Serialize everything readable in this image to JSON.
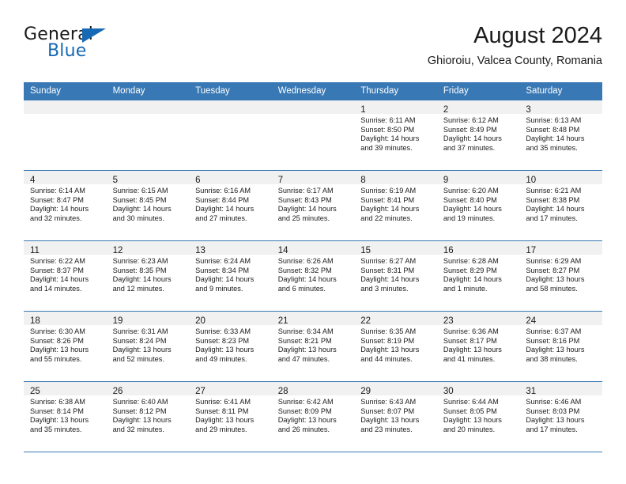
{
  "brand": {
    "name_top": "General",
    "name_bottom": "Blue",
    "accent_color": "#1669b5",
    "flag_icon": "triangle-flag-icon"
  },
  "header": {
    "title": "August 2024",
    "subtitle": "Ghioroiu, Valcea County, Romania"
  },
  "calendar": {
    "header_bg": "#3878b4",
    "daynum_bg": "#f1f1f1",
    "weekdays": [
      "Sunday",
      "Monday",
      "Tuesday",
      "Wednesday",
      "Thursday",
      "Friday",
      "Saturday"
    ],
    "labels": {
      "sunrise": "Sunrise:",
      "sunset": "Sunset:",
      "daylight": "Daylight:"
    },
    "weeks": [
      [
        {
          "day": ""
        },
        {
          "day": ""
        },
        {
          "day": ""
        },
        {
          "day": ""
        },
        {
          "day": "1",
          "sunrise": "Sunrise: 6:11 AM",
          "sunset": "Sunset: 8:50 PM",
          "daylight": "Daylight: 14 hours and 39 minutes."
        },
        {
          "day": "2",
          "sunrise": "Sunrise: 6:12 AM",
          "sunset": "Sunset: 8:49 PM",
          "daylight": "Daylight: 14 hours and 37 minutes."
        },
        {
          "day": "3",
          "sunrise": "Sunrise: 6:13 AM",
          "sunset": "Sunset: 8:48 PM",
          "daylight": "Daylight: 14 hours and 35 minutes."
        }
      ],
      [
        {
          "day": "4",
          "sunrise": "Sunrise: 6:14 AM",
          "sunset": "Sunset: 8:47 PM",
          "daylight": "Daylight: 14 hours and 32 minutes."
        },
        {
          "day": "5",
          "sunrise": "Sunrise: 6:15 AM",
          "sunset": "Sunset: 8:45 PM",
          "daylight": "Daylight: 14 hours and 30 minutes."
        },
        {
          "day": "6",
          "sunrise": "Sunrise: 6:16 AM",
          "sunset": "Sunset: 8:44 PM",
          "daylight": "Daylight: 14 hours and 27 minutes."
        },
        {
          "day": "7",
          "sunrise": "Sunrise: 6:17 AM",
          "sunset": "Sunset: 8:43 PM",
          "daylight": "Daylight: 14 hours and 25 minutes."
        },
        {
          "day": "8",
          "sunrise": "Sunrise: 6:19 AM",
          "sunset": "Sunset: 8:41 PM",
          "daylight": "Daylight: 14 hours and 22 minutes."
        },
        {
          "day": "9",
          "sunrise": "Sunrise: 6:20 AM",
          "sunset": "Sunset: 8:40 PM",
          "daylight": "Daylight: 14 hours and 19 minutes."
        },
        {
          "day": "10",
          "sunrise": "Sunrise: 6:21 AM",
          "sunset": "Sunset: 8:38 PM",
          "daylight": "Daylight: 14 hours and 17 minutes."
        }
      ],
      [
        {
          "day": "11",
          "sunrise": "Sunrise: 6:22 AM",
          "sunset": "Sunset: 8:37 PM",
          "daylight": "Daylight: 14 hours and 14 minutes."
        },
        {
          "day": "12",
          "sunrise": "Sunrise: 6:23 AM",
          "sunset": "Sunset: 8:35 PM",
          "daylight": "Daylight: 14 hours and 12 minutes."
        },
        {
          "day": "13",
          "sunrise": "Sunrise: 6:24 AM",
          "sunset": "Sunset: 8:34 PM",
          "daylight": "Daylight: 14 hours and 9 minutes."
        },
        {
          "day": "14",
          "sunrise": "Sunrise: 6:26 AM",
          "sunset": "Sunset: 8:32 PM",
          "daylight": "Daylight: 14 hours and 6 minutes."
        },
        {
          "day": "15",
          "sunrise": "Sunrise: 6:27 AM",
          "sunset": "Sunset: 8:31 PM",
          "daylight": "Daylight: 14 hours and 3 minutes."
        },
        {
          "day": "16",
          "sunrise": "Sunrise: 6:28 AM",
          "sunset": "Sunset: 8:29 PM",
          "daylight": "Daylight: 14 hours and 1 minute."
        },
        {
          "day": "17",
          "sunrise": "Sunrise: 6:29 AM",
          "sunset": "Sunset: 8:27 PM",
          "daylight": "Daylight: 13 hours and 58 minutes."
        }
      ],
      [
        {
          "day": "18",
          "sunrise": "Sunrise: 6:30 AM",
          "sunset": "Sunset: 8:26 PM",
          "daylight": "Daylight: 13 hours and 55 minutes."
        },
        {
          "day": "19",
          "sunrise": "Sunrise: 6:31 AM",
          "sunset": "Sunset: 8:24 PM",
          "daylight": "Daylight: 13 hours and 52 minutes."
        },
        {
          "day": "20",
          "sunrise": "Sunrise: 6:33 AM",
          "sunset": "Sunset: 8:23 PM",
          "daylight": "Daylight: 13 hours and 49 minutes."
        },
        {
          "day": "21",
          "sunrise": "Sunrise: 6:34 AM",
          "sunset": "Sunset: 8:21 PM",
          "daylight": "Daylight: 13 hours and 47 minutes."
        },
        {
          "day": "22",
          "sunrise": "Sunrise: 6:35 AM",
          "sunset": "Sunset: 8:19 PM",
          "daylight": "Daylight: 13 hours and 44 minutes."
        },
        {
          "day": "23",
          "sunrise": "Sunrise: 6:36 AM",
          "sunset": "Sunset: 8:17 PM",
          "daylight": "Daylight: 13 hours and 41 minutes."
        },
        {
          "day": "24",
          "sunrise": "Sunrise: 6:37 AM",
          "sunset": "Sunset: 8:16 PM",
          "daylight": "Daylight: 13 hours and 38 minutes."
        }
      ],
      [
        {
          "day": "25",
          "sunrise": "Sunrise: 6:38 AM",
          "sunset": "Sunset: 8:14 PM",
          "daylight": "Daylight: 13 hours and 35 minutes."
        },
        {
          "day": "26",
          "sunrise": "Sunrise: 6:40 AM",
          "sunset": "Sunset: 8:12 PM",
          "daylight": "Daylight: 13 hours and 32 minutes."
        },
        {
          "day": "27",
          "sunrise": "Sunrise: 6:41 AM",
          "sunset": "Sunset: 8:11 PM",
          "daylight": "Daylight: 13 hours and 29 minutes."
        },
        {
          "day": "28",
          "sunrise": "Sunrise: 6:42 AM",
          "sunset": "Sunset: 8:09 PM",
          "daylight": "Daylight: 13 hours and 26 minutes."
        },
        {
          "day": "29",
          "sunrise": "Sunrise: 6:43 AM",
          "sunset": "Sunset: 8:07 PM",
          "daylight": "Daylight: 13 hours and 23 minutes."
        },
        {
          "day": "30",
          "sunrise": "Sunrise: 6:44 AM",
          "sunset": "Sunset: 8:05 PM",
          "daylight": "Daylight: 13 hours and 20 minutes."
        },
        {
          "day": "31",
          "sunrise": "Sunrise: 6:46 AM",
          "sunset": "Sunset: 8:03 PM",
          "daylight": "Daylight: 13 hours and 17 minutes."
        }
      ]
    ]
  }
}
